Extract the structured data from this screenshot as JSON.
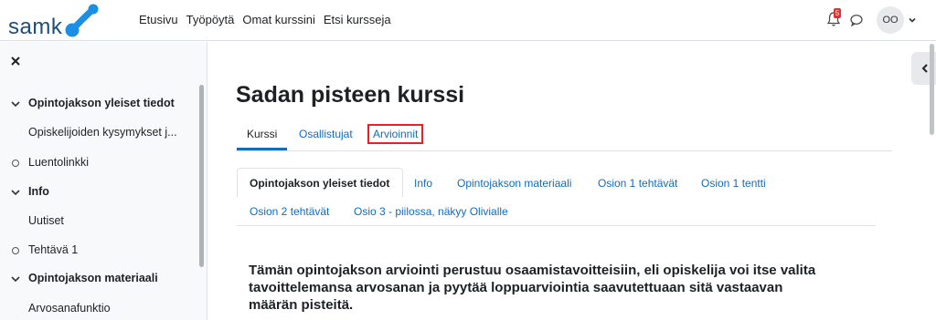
{
  "brand": {
    "logo_text": "samk",
    "accent": "#0f6cbf",
    "logo_dot_color": "#1a8fe3"
  },
  "navbar": {
    "links": [
      "Etusivu",
      "Työpöytä",
      "Omat kurssini",
      "Etsi kursseja"
    ],
    "notification_count": "5",
    "avatar_initials": "OO"
  },
  "drawer": {
    "items": [
      {
        "label": "Opintojakson yleiset tiedot",
        "kind": "section"
      },
      {
        "label": "Opiskelijoiden kysymykset j...",
        "kind": "sub"
      },
      {
        "label": "Luentolinkki",
        "kind": "circle"
      },
      {
        "label": "Info",
        "kind": "section"
      },
      {
        "label": "Uutiset",
        "kind": "sub"
      },
      {
        "label": "Tehtävä 1",
        "kind": "circle"
      },
      {
        "label": "Opintojakson materiaali",
        "kind": "section"
      },
      {
        "label": "Arvosanafunktio",
        "kind": "sub"
      }
    ]
  },
  "main": {
    "title": "Sadan pisteen kurssi",
    "secondary_nav": [
      "Kurssi",
      "Osallistujat",
      "Arvioinnit"
    ],
    "course_tabs_row1": [
      "Opintojakson yleiset tiedot",
      "Info",
      "Opintojakson materiaali",
      "Osion 1 tehtävät",
      "Osion 1 tentti"
    ],
    "course_tabs_row2": [
      "Osion 2 tehtävät",
      "Osio 3 - piilossa, näkyy Olivialle"
    ],
    "summary": "Tämän opintojakson arviointi perustuu osaamistavoitteisiin, eli opiskelija voi itse valita tavoittelemansa arvosanan ja pyytää loppuarviointia saavutettuaan sitä vastaavan määrän pisteitä."
  }
}
